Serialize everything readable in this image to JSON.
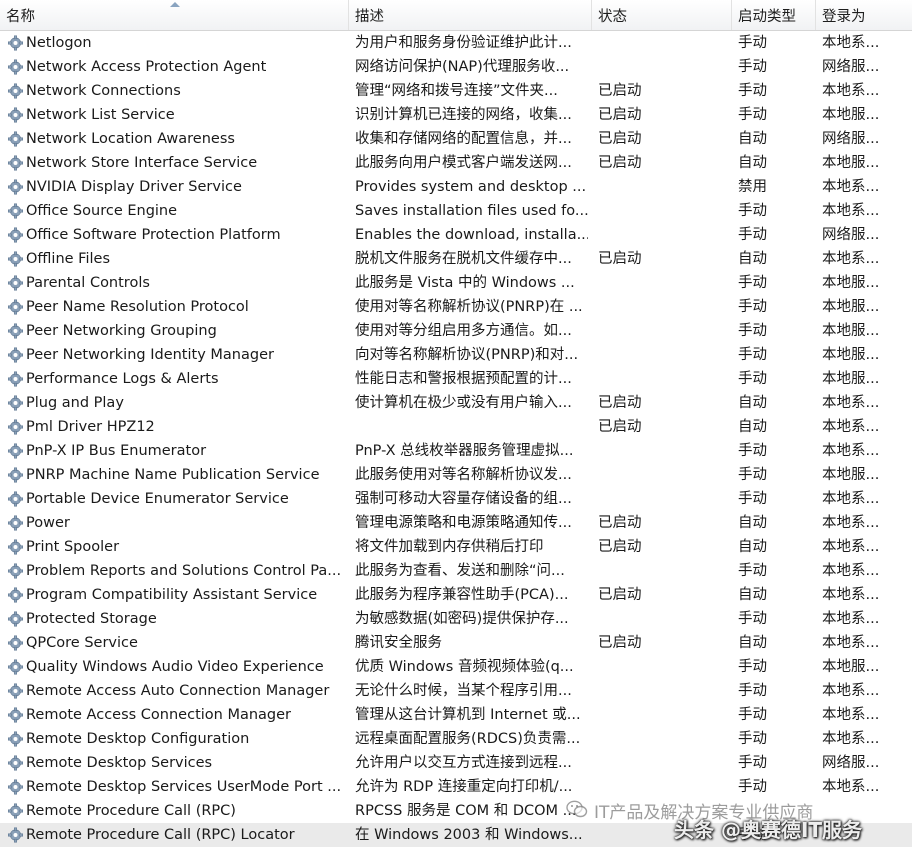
{
  "columns": {
    "name": "名称",
    "desc": "描述",
    "status": "状态",
    "startup": "启动类型",
    "logon": "登录为"
  },
  "rows": [
    {
      "name": "Netlogon",
      "desc": "为用户和服务身份验证维护此计...",
      "status": "",
      "startup": "手动",
      "logon": "本地系..."
    },
    {
      "name": "Network Access Protection Agent",
      "desc": "网络访问保护(NAP)代理服务收...",
      "status": "",
      "startup": "手动",
      "logon": "网络服..."
    },
    {
      "name": "Network Connections",
      "desc": "管理“网络和拨号连接”文件夹...",
      "status": "已启动",
      "startup": "手动",
      "logon": "本地系..."
    },
    {
      "name": "Network List Service",
      "desc": "识别计算机已连接的网络，收集...",
      "status": "已启动",
      "startup": "手动",
      "logon": "本地服..."
    },
    {
      "name": "Network Location Awareness",
      "desc": "收集和存储网络的配置信息，并...",
      "status": "已启动",
      "startup": "自动",
      "logon": "网络服..."
    },
    {
      "name": "Network Store Interface Service",
      "desc": "此服务向用户模式客户端发送网...",
      "status": "已启动",
      "startup": "自动",
      "logon": "本地服..."
    },
    {
      "name": "NVIDIA Display Driver Service",
      "desc": "Provides system and desktop ...",
      "status": "",
      "startup": "禁用",
      "logon": "本地系..."
    },
    {
      "name": "Office  Source Engine",
      "desc": "Saves installation files used fo...",
      "status": "",
      "startup": "手动",
      "logon": "本地系..."
    },
    {
      "name": "Office Software Protection Platform",
      "desc": "Enables the download, installa...",
      "status": "",
      "startup": "手动",
      "logon": "网络服..."
    },
    {
      "name": "Offline Files",
      "desc": "脱机文件服务在脱机文件缓存中...",
      "status": "已启动",
      "startup": "自动",
      "logon": "本地系..."
    },
    {
      "name": "Parental Controls",
      "desc": "此服务是 Vista 中的 Windows ...",
      "status": "",
      "startup": "手动",
      "logon": "本地服..."
    },
    {
      "name": "Peer Name Resolution Protocol",
      "desc": "使用对等名称解析协议(PNRP)在 ...",
      "status": "",
      "startup": "手动",
      "logon": "本地服..."
    },
    {
      "name": "Peer Networking Grouping",
      "desc": "使用对等分组启用多方通信。如...",
      "status": "",
      "startup": "手动",
      "logon": "本地服..."
    },
    {
      "name": "Peer Networking Identity Manager",
      "desc": "向对等名称解析协议(PNRP)和对...",
      "status": "",
      "startup": "手动",
      "logon": "本地服..."
    },
    {
      "name": "Performance Logs & Alerts",
      "desc": "性能日志和警报根据预配置的计...",
      "status": "",
      "startup": "手动",
      "logon": "本地服..."
    },
    {
      "name": "Plug and Play",
      "desc": "使计算机在极少或没有用户输入...",
      "status": "已启动",
      "startup": "自动",
      "logon": "本地系..."
    },
    {
      "name": "Pml Driver HPZ12",
      "desc": "",
      "status": "已启动",
      "startup": "自动",
      "logon": "本地系..."
    },
    {
      "name": "PnP-X IP Bus Enumerator",
      "desc": "PnP-X 总线枚举器服务管理虚拟...",
      "status": "",
      "startup": "手动",
      "logon": "本地系..."
    },
    {
      "name": "PNRP Machine Name Publication Service",
      "desc": "此服务使用对等名称解析协议发...",
      "status": "",
      "startup": "手动",
      "logon": "本地服..."
    },
    {
      "name": "Portable Device Enumerator Service",
      "desc": "强制可移动大容量存储设备的组...",
      "status": "",
      "startup": "手动",
      "logon": "本地系..."
    },
    {
      "name": "Power",
      "desc": "管理电源策略和电源策略通知传...",
      "status": "已启动",
      "startup": "自动",
      "logon": "本地系..."
    },
    {
      "name": "Print Spooler",
      "desc": "将文件加载到内存供稍后打印",
      "status": "已启动",
      "startup": "自动",
      "logon": "本地系..."
    },
    {
      "name": "Problem Reports and Solutions Control Pa...",
      "desc": "此服务为查看、发送和删除“问...",
      "status": "",
      "startup": "手动",
      "logon": "本地系..."
    },
    {
      "name": "Program Compatibility Assistant Service",
      "desc": "此服务为程序兼容性助手(PCA)...",
      "status": "已启动",
      "startup": "自动",
      "logon": "本地系..."
    },
    {
      "name": "Protected Storage",
      "desc": "为敏感数据(如密码)提供保护存...",
      "status": "",
      "startup": "手动",
      "logon": "本地系..."
    },
    {
      "name": "QPCore Service",
      "desc": "腾讯安全服务",
      "status": "已启动",
      "startup": "自动",
      "logon": "本地系..."
    },
    {
      "name": "Quality Windows Audio Video Experience",
      "desc": "优质 Windows 音频视频体验(q...",
      "status": "",
      "startup": "手动",
      "logon": "本地服..."
    },
    {
      "name": "Remote Access Auto Connection Manager",
      "desc": "无论什么时候，当某个程序引用...",
      "status": "",
      "startup": "手动",
      "logon": "本地系..."
    },
    {
      "name": "Remote Access Connection Manager",
      "desc": "管理从这台计算机到 Internet 或...",
      "status": "",
      "startup": "手动",
      "logon": "本地系..."
    },
    {
      "name": "Remote Desktop Configuration",
      "desc": "远程桌面配置服务(RDCS)负责需...",
      "status": "",
      "startup": "手动",
      "logon": "本地系..."
    },
    {
      "name": "Remote Desktop Services",
      "desc": "允许用户以交互方式连接到远程...",
      "status": "",
      "startup": "手动",
      "logon": "网络服..."
    },
    {
      "name": "Remote Desktop Services UserMode Port ...",
      "desc": "允许为 RDP 连接重定向打印机/...",
      "status": "",
      "startup": "手动",
      "logon": "本地系..."
    },
    {
      "name": "Remote Procedure Call (RPC)",
      "desc": "RPCSS 服务是 COM 和 DCOM ...",
      "status": "",
      "startup": "",
      "logon": ""
    },
    {
      "name": "Remote Procedure Call (RPC) Locator",
      "desc": "在 Windows 2003 和 Windows...",
      "status": "",
      "startup": "手动",
      "logon": ""
    }
  ],
  "watermark": {
    "line1": "IT产品及解决方案专业供应商",
    "line2": "头条 @奥赛德IT服务"
  },
  "colors": {
    "header_bg": "#f1f2f4",
    "selected_row": "#eaeaea",
    "gear": "#8aa0b8"
  },
  "icons": {
    "row": "gear-icon",
    "sort": "sort-ascending-arrow-icon",
    "watermark": "wechat-logo-icon"
  }
}
